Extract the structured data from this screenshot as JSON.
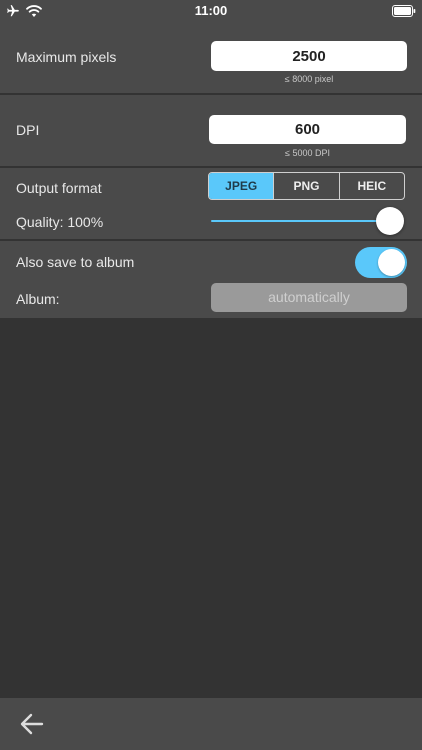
{
  "status_bar": {
    "time": "11:00",
    "icons": [
      "airplane-icon",
      "wifi-icon",
      "battery-icon"
    ]
  },
  "max_pixels": {
    "label": "Maximum pixels",
    "value": "2500",
    "hint": "≤ 8000 pixel"
  },
  "dpi": {
    "label": "DPI",
    "value": "600",
    "hint": "≤ 5000 DPI"
  },
  "output": {
    "label": "Output format",
    "formats": [
      "JPEG",
      "PNG",
      "HEIC"
    ],
    "selected": "JPEG",
    "quality_label": "Quality: 100%",
    "quality_percent": 100
  },
  "album": {
    "save_label": "Also save to album",
    "save_enabled": true,
    "album_label": "Album:",
    "album_value": "automatically"
  },
  "bottom_bar": {
    "back_icon": "arrow-left-icon"
  },
  "colors": {
    "accent": "#5ac8fa",
    "background": "#333333",
    "panel": "#4a4a4a"
  }
}
